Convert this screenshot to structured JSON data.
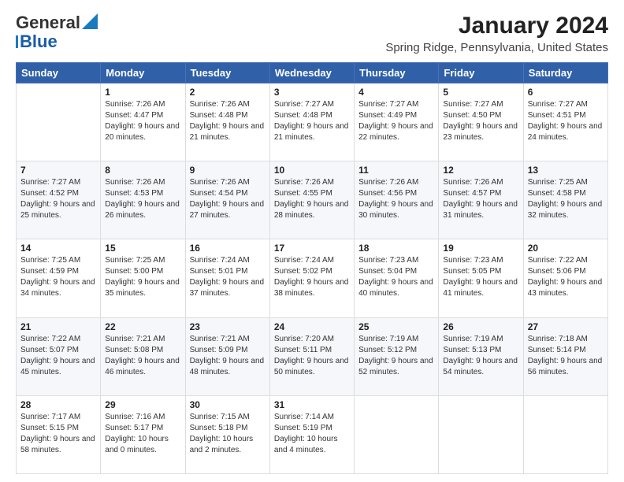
{
  "header": {
    "logo": {
      "line1": "General",
      "line2": "Blue"
    },
    "title": "January 2024",
    "location": "Spring Ridge, Pennsylvania, United States"
  },
  "columns": [
    "Sunday",
    "Monday",
    "Tuesday",
    "Wednesday",
    "Thursday",
    "Friday",
    "Saturday"
  ],
  "weeks": [
    [
      {
        "day": "",
        "sunrise": "",
        "sunset": "",
        "daylight": ""
      },
      {
        "day": "1",
        "sunrise": "Sunrise: 7:26 AM",
        "sunset": "Sunset: 4:47 PM",
        "daylight": "Daylight: 9 hours and 20 minutes."
      },
      {
        "day": "2",
        "sunrise": "Sunrise: 7:26 AM",
        "sunset": "Sunset: 4:48 PM",
        "daylight": "Daylight: 9 hours and 21 minutes."
      },
      {
        "day": "3",
        "sunrise": "Sunrise: 7:27 AM",
        "sunset": "Sunset: 4:48 PM",
        "daylight": "Daylight: 9 hours and 21 minutes."
      },
      {
        "day": "4",
        "sunrise": "Sunrise: 7:27 AM",
        "sunset": "Sunset: 4:49 PM",
        "daylight": "Daylight: 9 hours and 22 minutes."
      },
      {
        "day": "5",
        "sunrise": "Sunrise: 7:27 AM",
        "sunset": "Sunset: 4:50 PM",
        "daylight": "Daylight: 9 hours and 23 minutes."
      },
      {
        "day": "6",
        "sunrise": "Sunrise: 7:27 AM",
        "sunset": "Sunset: 4:51 PM",
        "daylight": "Daylight: 9 hours and 24 minutes."
      }
    ],
    [
      {
        "day": "7",
        "sunrise": "Sunrise: 7:27 AM",
        "sunset": "Sunset: 4:52 PM",
        "daylight": "Daylight: 9 hours and 25 minutes."
      },
      {
        "day": "8",
        "sunrise": "Sunrise: 7:26 AM",
        "sunset": "Sunset: 4:53 PM",
        "daylight": "Daylight: 9 hours and 26 minutes."
      },
      {
        "day": "9",
        "sunrise": "Sunrise: 7:26 AM",
        "sunset": "Sunset: 4:54 PM",
        "daylight": "Daylight: 9 hours and 27 minutes."
      },
      {
        "day": "10",
        "sunrise": "Sunrise: 7:26 AM",
        "sunset": "Sunset: 4:55 PM",
        "daylight": "Daylight: 9 hours and 28 minutes."
      },
      {
        "day": "11",
        "sunrise": "Sunrise: 7:26 AM",
        "sunset": "Sunset: 4:56 PM",
        "daylight": "Daylight: 9 hours and 30 minutes."
      },
      {
        "day": "12",
        "sunrise": "Sunrise: 7:26 AM",
        "sunset": "Sunset: 4:57 PM",
        "daylight": "Daylight: 9 hours and 31 minutes."
      },
      {
        "day": "13",
        "sunrise": "Sunrise: 7:25 AM",
        "sunset": "Sunset: 4:58 PM",
        "daylight": "Daylight: 9 hours and 32 minutes."
      }
    ],
    [
      {
        "day": "14",
        "sunrise": "Sunrise: 7:25 AM",
        "sunset": "Sunset: 4:59 PM",
        "daylight": "Daylight: 9 hours and 34 minutes."
      },
      {
        "day": "15",
        "sunrise": "Sunrise: 7:25 AM",
        "sunset": "Sunset: 5:00 PM",
        "daylight": "Daylight: 9 hours and 35 minutes."
      },
      {
        "day": "16",
        "sunrise": "Sunrise: 7:24 AM",
        "sunset": "Sunset: 5:01 PM",
        "daylight": "Daylight: 9 hours and 37 minutes."
      },
      {
        "day": "17",
        "sunrise": "Sunrise: 7:24 AM",
        "sunset": "Sunset: 5:02 PM",
        "daylight": "Daylight: 9 hours and 38 minutes."
      },
      {
        "day": "18",
        "sunrise": "Sunrise: 7:23 AM",
        "sunset": "Sunset: 5:04 PM",
        "daylight": "Daylight: 9 hours and 40 minutes."
      },
      {
        "day": "19",
        "sunrise": "Sunrise: 7:23 AM",
        "sunset": "Sunset: 5:05 PM",
        "daylight": "Daylight: 9 hours and 41 minutes."
      },
      {
        "day": "20",
        "sunrise": "Sunrise: 7:22 AM",
        "sunset": "Sunset: 5:06 PM",
        "daylight": "Daylight: 9 hours and 43 minutes."
      }
    ],
    [
      {
        "day": "21",
        "sunrise": "Sunrise: 7:22 AM",
        "sunset": "Sunset: 5:07 PM",
        "daylight": "Daylight: 9 hours and 45 minutes."
      },
      {
        "day": "22",
        "sunrise": "Sunrise: 7:21 AM",
        "sunset": "Sunset: 5:08 PM",
        "daylight": "Daylight: 9 hours and 46 minutes."
      },
      {
        "day": "23",
        "sunrise": "Sunrise: 7:21 AM",
        "sunset": "Sunset: 5:09 PM",
        "daylight": "Daylight: 9 hours and 48 minutes."
      },
      {
        "day": "24",
        "sunrise": "Sunrise: 7:20 AM",
        "sunset": "Sunset: 5:11 PM",
        "daylight": "Daylight: 9 hours and 50 minutes."
      },
      {
        "day": "25",
        "sunrise": "Sunrise: 7:19 AM",
        "sunset": "Sunset: 5:12 PM",
        "daylight": "Daylight: 9 hours and 52 minutes."
      },
      {
        "day": "26",
        "sunrise": "Sunrise: 7:19 AM",
        "sunset": "Sunset: 5:13 PM",
        "daylight": "Daylight: 9 hours and 54 minutes."
      },
      {
        "day": "27",
        "sunrise": "Sunrise: 7:18 AM",
        "sunset": "Sunset: 5:14 PM",
        "daylight": "Daylight: 9 hours and 56 minutes."
      }
    ],
    [
      {
        "day": "28",
        "sunrise": "Sunrise: 7:17 AM",
        "sunset": "Sunset: 5:15 PM",
        "daylight": "Daylight: 9 hours and 58 minutes."
      },
      {
        "day": "29",
        "sunrise": "Sunrise: 7:16 AM",
        "sunset": "Sunset: 5:17 PM",
        "daylight": "Daylight: 10 hours and 0 minutes."
      },
      {
        "day": "30",
        "sunrise": "Sunrise: 7:15 AM",
        "sunset": "Sunset: 5:18 PM",
        "daylight": "Daylight: 10 hours and 2 minutes."
      },
      {
        "day": "31",
        "sunrise": "Sunrise: 7:14 AM",
        "sunset": "Sunset: 5:19 PM",
        "daylight": "Daylight: 10 hours and 4 minutes."
      },
      {
        "day": "",
        "sunrise": "",
        "sunset": "",
        "daylight": ""
      },
      {
        "day": "",
        "sunrise": "",
        "sunset": "",
        "daylight": ""
      },
      {
        "day": "",
        "sunrise": "",
        "sunset": "",
        "daylight": ""
      }
    ]
  ]
}
